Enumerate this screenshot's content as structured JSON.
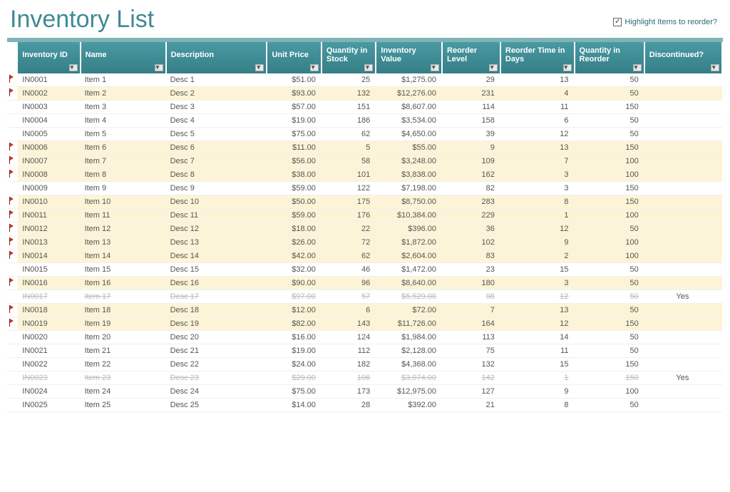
{
  "title": "Inventory List",
  "highlight": {
    "label": "Highlight Items to reorder?",
    "checked": true
  },
  "columns": [
    "Inventory ID",
    "Name",
    "Description",
    "Unit Price",
    "Quantity in Stock",
    "Inventory Value",
    "Reorder Level",
    "Reorder Time in Days",
    "Quantity in Reorder",
    "Discontinued?"
  ],
  "rows": [
    {
      "flag": true,
      "hl": false,
      "disc": false,
      "id": "IN0001",
      "name": "Item 1",
      "desc": "Desc 1",
      "price": "$51.00",
      "stock": "25",
      "value": "$1,275.00",
      "rlevel": "29",
      "rtime": "13",
      "qro": "50",
      "discv": ""
    },
    {
      "flag": true,
      "hl": true,
      "disc": false,
      "id": "IN0002",
      "name": "Item 2",
      "desc": "Desc 2",
      "price": "$93.00",
      "stock": "132",
      "value": "$12,276.00",
      "rlevel": "231",
      "rtime": "4",
      "qro": "50",
      "discv": ""
    },
    {
      "flag": false,
      "hl": false,
      "disc": false,
      "id": "IN0003",
      "name": "Item 3",
      "desc": "Desc 3",
      "price": "$57.00",
      "stock": "151",
      "value": "$8,607.00",
      "rlevel": "114",
      "rtime": "11",
      "qro": "150",
      "discv": ""
    },
    {
      "flag": false,
      "hl": false,
      "disc": false,
      "id": "IN0004",
      "name": "Item 4",
      "desc": "Desc 4",
      "price": "$19.00",
      "stock": "186",
      "value": "$3,534.00",
      "rlevel": "158",
      "rtime": "6",
      "qro": "50",
      "discv": ""
    },
    {
      "flag": false,
      "hl": false,
      "disc": false,
      "id": "IN0005",
      "name": "Item 5",
      "desc": "Desc 5",
      "price": "$75.00",
      "stock": "62",
      "value": "$4,650.00",
      "rlevel": "39",
      "rtime": "12",
      "qro": "50",
      "discv": ""
    },
    {
      "flag": true,
      "hl": true,
      "disc": false,
      "id": "IN0006",
      "name": "Item 6",
      "desc": "Desc 6",
      "price": "$11.00",
      "stock": "5",
      "value": "$55.00",
      "rlevel": "9",
      "rtime": "13",
      "qro": "150",
      "discv": ""
    },
    {
      "flag": true,
      "hl": true,
      "disc": false,
      "id": "IN0007",
      "name": "Item 7",
      "desc": "Desc 7",
      "price": "$56.00",
      "stock": "58",
      "value": "$3,248.00",
      "rlevel": "109",
      "rtime": "7",
      "qro": "100",
      "discv": ""
    },
    {
      "flag": true,
      "hl": true,
      "disc": false,
      "id": "IN0008",
      "name": "Item 8",
      "desc": "Desc 8",
      "price": "$38.00",
      "stock": "101",
      "value": "$3,838.00",
      "rlevel": "162",
      "rtime": "3",
      "qro": "100",
      "discv": ""
    },
    {
      "flag": false,
      "hl": false,
      "disc": false,
      "id": "IN0009",
      "name": "Item 9",
      "desc": "Desc 9",
      "price": "$59.00",
      "stock": "122",
      "value": "$7,198.00",
      "rlevel": "82",
      "rtime": "3",
      "qro": "150",
      "discv": ""
    },
    {
      "flag": true,
      "hl": true,
      "disc": false,
      "id": "IN0010",
      "name": "Item 10",
      "desc": "Desc 10",
      "price": "$50.00",
      "stock": "175",
      "value": "$8,750.00",
      "rlevel": "283",
      "rtime": "8",
      "qro": "150",
      "discv": ""
    },
    {
      "flag": true,
      "hl": true,
      "disc": false,
      "id": "IN0011",
      "name": "Item 11",
      "desc": "Desc 11",
      "price": "$59.00",
      "stock": "176",
      "value": "$10,384.00",
      "rlevel": "229",
      "rtime": "1",
      "qro": "100",
      "discv": ""
    },
    {
      "flag": true,
      "hl": true,
      "disc": false,
      "id": "IN0012",
      "name": "Item 12",
      "desc": "Desc 12",
      "price": "$18.00",
      "stock": "22",
      "value": "$396.00",
      "rlevel": "36",
      "rtime": "12",
      "qro": "50",
      "discv": ""
    },
    {
      "flag": true,
      "hl": true,
      "disc": false,
      "id": "IN0013",
      "name": "Item 13",
      "desc": "Desc 13",
      "price": "$26.00",
      "stock": "72",
      "value": "$1,872.00",
      "rlevel": "102",
      "rtime": "9",
      "qro": "100",
      "discv": ""
    },
    {
      "flag": true,
      "hl": true,
      "disc": false,
      "id": "IN0014",
      "name": "Item 14",
      "desc": "Desc 14",
      "price": "$42.00",
      "stock": "62",
      "value": "$2,604.00",
      "rlevel": "83",
      "rtime": "2",
      "qro": "100",
      "discv": ""
    },
    {
      "flag": false,
      "hl": false,
      "disc": false,
      "id": "IN0015",
      "name": "Item 15",
      "desc": "Desc 15",
      "price": "$32.00",
      "stock": "46",
      "value": "$1,472.00",
      "rlevel": "23",
      "rtime": "15",
      "qro": "50",
      "discv": ""
    },
    {
      "flag": true,
      "hl": true,
      "disc": false,
      "id": "IN0016",
      "name": "Item 16",
      "desc": "Desc 16",
      "price": "$90.00",
      "stock": "96",
      "value": "$8,640.00",
      "rlevel": "180",
      "rtime": "3",
      "qro": "50",
      "discv": ""
    },
    {
      "flag": false,
      "hl": false,
      "disc": true,
      "id": "IN0017",
      "name": "Item 17",
      "desc": "Desc 17",
      "price": "$97.00",
      "stock": "57",
      "value": "$5,529.00",
      "rlevel": "98",
      "rtime": "12",
      "qro": "50",
      "discv": "Yes"
    },
    {
      "flag": true,
      "hl": true,
      "disc": false,
      "id": "IN0018",
      "name": "Item 18",
      "desc": "Desc 18",
      "price": "$12.00",
      "stock": "6",
      "value": "$72.00",
      "rlevel": "7",
      "rtime": "13",
      "qro": "50",
      "discv": ""
    },
    {
      "flag": true,
      "hl": true,
      "disc": false,
      "id": "IN0019",
      "name": "Item 19",
      "desc": "Desc 19",
      "price": "$82.00",
      "stock": "143",
      "value": "$11,726.00",
      "rlevel": "164",
      "rtime": "12",
      "qro": "150",
      "discv": ""
    },
    {
      "flag": false,
      "hl": false,
      "disc": false,
      "id": "IN0020",
      "name": "Item 20",
      "desc": "Desc 20",
      "price": "$16.00",
      "stock": "124",
      "value": "$1,984.00",
      "rlevel": "113",
      "rtime": "14",
      "qro": "50",
      "discv": ""
    },
    {
      "flag": false,
      "hl": false,
      "disc": false,
      "id": "IN0021",
      "name": "Item 21",
      "desc": "Desc 21",
      "price": "$19.00",
      "stock": "112",
      "value": "$2,128.00",
      "rlevel": "75",
      "rtime": "11",
      "qro": "50",
      "discv": ""
    },
    {
      "flag": false,
      "hl": false,
      "disc": false,
      "id": "IN0022",
      "name": "Item 22",
      "desc": "Desc 22",
      "price": "$24.00",
      "stock": "182",
      "value": "$4,368.00",
      "rlevel": "132",
      "rtime": "15",
      "qro": "150",
      "discv": ""
    },
    {
      "flag": false,
      "hl": false,
      "disc": true,
      "id": "IN0023",
      "name": "Item 23",
      "desc": "Desc 23",
      "price": "$29.00",
      "stock": "106",
      "value": "$3,074.00",
      "rlevel": "142",
      "rtime": "1",
      "qro": "150",
      "discv": "Yes"
    },
    {
      "flag": false,
      "hl": false,
      "disc": false,
      "id": "IN0024",
      "name": "Item 24",
      "desc": "Desc 24",
      "price": "$75.00",
      "stock": "173",
      "value": "$12,975.00",
      "rlevel": "127",
      "rtime": "9",
      "qro": "100",
      "discv": ""
    },
    {
      "flag": false,
      "hl": false,
      "disc": false,
      "id": "IN0025",
      "name": "Item 25",
      "desc": "Desc 25",
      "price": "$14.00",
      "stock": "28",
      "value": "$392.00",
      "rlevel": "21",
      "rtime": "8",
      "qro": "50",
      "discv": ""
    }
  ]
}
